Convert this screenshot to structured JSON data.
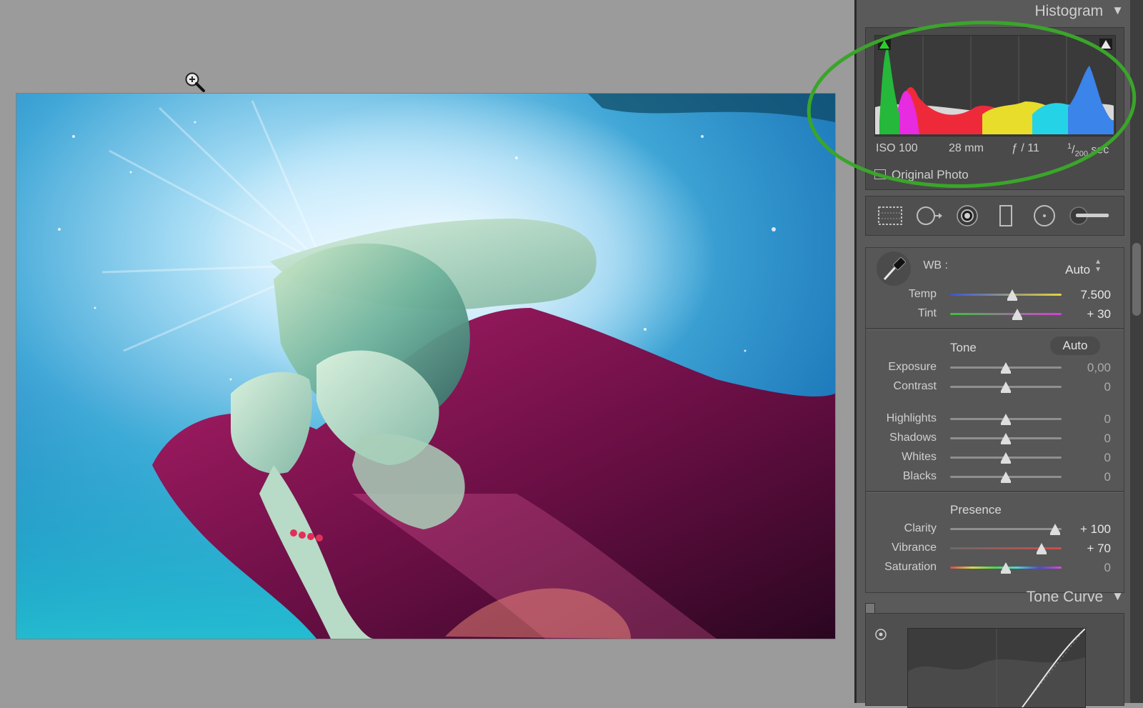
{
  "histogram": {
    "title": "Histogram",
    "exif": {
      "iso": "ISO 100",
      "focal": "28 mm",
      "aperture": "ƒ / 11",
      "shutter_num": "1",
      "shutter_den": "200",
      "shutter_unit": "sec"
    },
    "original_photo_label": "Original Photo",
    "original_photo_checked": false
  },
  "basic": {
    "wb_label": "WB :",
    "wb_value": "Auto",
    "tone_title": "Tone",
    "tone_auto_label": "Auto",
    "presence_title": "Presence",
    "sliders": {
      "temp": {
        "label": "Temp",
        "value": "7.500",
        "position": 0.56,
        "zero": false
      },
      "tint": {
        "label": "Tint",
        "value": "+ 30",
        "position": 0.6,
        "zero": false
      },
      "exposure": {
        "label": "Exposure",
        "value": "0,00",
        "position": 0.5,
        "zero": true
      },
      "contrast": {
        "label": "Contrast",
        "value": "0",
        "position": 0.5,
        "zero": true
      },
      "highlights": {
        "label": "Highlights",
        "value": "0",
        "position": 0.5,
        "zero": true
      },
      "shadows": {
        "label": "Shadows",
        "value": "0",
        "position": 0.5,
        "zero": true
      },
      "whites": {
        "label": "Whites",
        "value": "0",
        "position": 0.5,
        "zero": true
      },
      "blacks": {
        "label": "Blacks",
        "value": "0",
        "position": 0.5,
        "zero": true
      },
      "clarity": {
        "label": "Clarity",
        "value": "+ 100",
        "position": 0.94,
        "zero": false
      },
      "vibrance": {
        "label": "Vibrance",
        "value": "+ 70",
        "position": 0.82,
        "zero": false
      },
      "saturation": {
        "label": "Saturation",
        "value": "0",
        "position": 0.5,
        "zero": true
      }
    }
  },
  "tone_curve": {
    "title": "Tone Curve"
  },
  "colors": {
    "annotation_ring": "#3aa52a",
    "temp_track": [
      "#3b55d6",
      "#e6d23a"
    ],
    "tint_track": [
      "#3fbf3f",
      "#d63fd6"
    ],
    "vibrance_track": [
      "#6a6a6a",
      "#d44a4a"
    ],
    "saturation_track": [
      "#d84a4a",
      "#d8d84a",
      "#4ad84a",
      "#4ad8d8",
      "#4a4ad8",
      "#d84ad8"
    ]
  },
  "icons": {
    "zoom": "zoom-in-icon",
    "clip_shadows": "clipping-shadows-icon",
    "clip_highlights": "clipping-highlights-icon",
    "tools": [
      "crop-overlay-icon",
      "spot-removal-icon",
      "red-eye-icon",
      "graduated-filter-icon",
      "radial-filter-icon",
      "adjustment-brush-icon"
    ]
  }
}
